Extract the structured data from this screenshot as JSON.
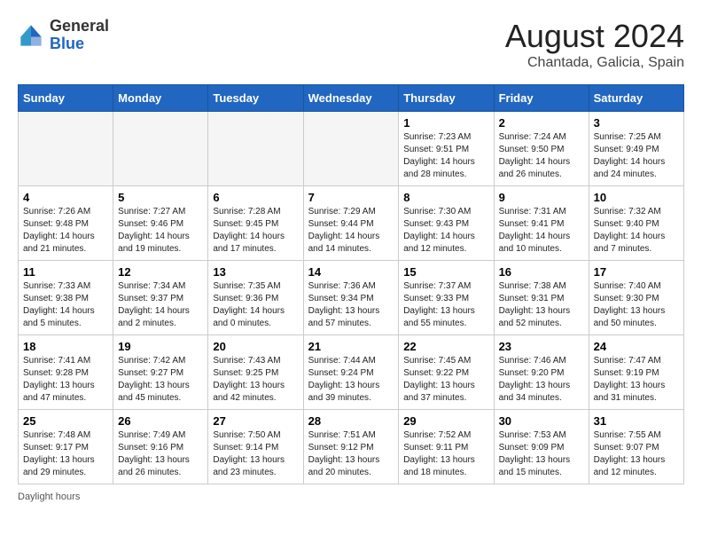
{
  "header": {
    "logo_general": "General",
    "logo_blue": "Blue",
    "title": "August 2024",
    "subtitle": "Chantada, Galicia, Spain"
  },
  "days_of_week": [
    "Sunday",
    "Monday",
    "Tuesday",
    "Wednesday",
    "Thursday",
    "Friday",
    "Saturday"
  ],
  "weeks": [
    [
      {
        "day": "",
        "info": ""
      },
      {
        "day": "",
        "info": ""
      },
      {
        "day": "",
        "info": ""
      },
      {
        "day": "",
        "info": ""
      },
      {
        "day": "1",
        "info": "Sunrise: 7:23 AM\nSunset: 9:51 PM\nDaylight: 14 hours\nand 28 minutes."
      },
      {
        "day": "2",
        "info": "Sunrise: 7:24 AM\nSunset: 9:50 PM\nDaylight: 14 hours\nand 26 minutes."
      },
      {
        "day": "3",
        "info": "Sunrise: 7:25 AM\nSunset: 9:49 PM\nDaylight: 14 hours\nand 24 minutes."
      }
    ],
    [
      {
        "day": "4",
        "info": "Sunrise: 7:26 AM\nSunset: 9:48 PM\nDaylight: 14 hours\nand 21 minutes."
      },
      {
        "day": "5",
        "info": "Sunrise: 7:27 AM\nSunset: 9:46 PM\nDaylight: 14 hours\nand 19 minutes."
      },
      {
        "day": "6",
        "info": "Sunrise: 7:28 AM\nSunset: 9:45 PM\nDaylight: 14 hours\nand 17 minutes."
      },
      {
        "day": "7",
        "info": "Sunrise: 7:29 AM\nSunset: 9:44 PM\nDaylight: 14 hours\nand 14 minutes."
      },
      {
        "day": "8",
        "info": "Sunrise: 7:30 AM\nSunset: 9:43 PM\nDaylight: 14 hours\nand 12 minutes."
      },
      {
        "day": "9",
        "info": "Sunrise: 7:31 AM\nSunset: 9:41 PM\nDaylight: 14 hours\nand 10 minutes."
      },
      {
        "day": "10",
        "info": "Sunrise: 7:32 AM\nSunset: 9:40 PM\nDaylight: 14 hours\nand 7 minutes."
      }
    ],
    [
      {
        "day": "11",
        "info": "Sunrise: 7:33 AM\nSunset: 9:38 PM\nDaylight: 14 hours\nand 5 minutes."
      },
      {
        "day": "12",
        "info": "Sunrise: 7:34 AM\nSunset: 9:37 PM\nDaylight: 14 hours\nand 2 minutes."
      },
      {
        "day": "13",
        "info": "Sunrise: 7:35 AM\nSunset: 9:36 PM\nDaylight: 14 hours\nand 0 minutes."
      },
      {
        "day": "14",
        "info": "Sunrise: 7:36 AM\nSunset: 9:34 PM\nDaylight: 13 hours\nand 57 minutes."
      },
      {
        "day": "15",
        "info": "Sunrise: 7:37 AM\nSunset: 9:33 PM\nDaylight: 13 hours\nand 55 minutes."
      },
      {
        "day": "16",
        "info": "Sunrise: 7:38 AM\nSunset: 9:31 PM\nDaylight: 13 hours\nand 52 minutes."
      },
      {
        "day": "17",
        "info": "Sunrise: 7:40 AM\nSunset: 9:30 PM\nDaylight: 13 hours\nand 50 minutes."
      }
    ],
    [
      {
        "day": "18",
        "info": "Sunrise: 7:41 AM\nSunset: 9:28 PM\nDaylight: 13 hours\nand 47 minutes."
      },
      {
        "day": "19",
        "info": "Sunrise: 7:42 AM\nSunset: 9:27 PM\nDaylight: 13 hours\nand 45 minutes."
      },
      {
        "day": "20",
        "info": "Sunrise: 7:43 AM\nSunset: 9:25 PM\nDaylight: 13 hours\nand 42 minutes."
      },
      {
        "day": "21",
        "info": "Sunrise: 7:44 AM\nSunset: 9:24 PM\nDaylight: 13 hours\nand 39 minutes."
      },
      {
        "day": "22",
        "info": "Sunrise: 7:45 AM\nSunset: 9:22 PM\nDaylight: 13 hours\nand 37 minutes."
      },
      {
        "day": "23",
        "info": "Sunrise: 7:46 AM\nSunset: 9:20 PM\nDaylight: 13 hours\nand 34 minutes."
      },
      {
        "day": "24",
        "info": "Sunrise: 7:47 AM\nSunset: 9:19 PM\nDaylight: 13 hours\nand 31 minutes."
      }
    ],
    [
      {
        "day": "25",
        "info": "Sunrise: 7:48 AM\nSunset: 9:17 PM\nDaylight: 13 hours\nand 29 minutes."
      },
      {
        "day": "26",
        "info": "Sunrise: 7:49 AM\nSunset: 9:16 PM\nDaylight: 13 hours\nand 26 minutes."
      },
      {
        "day": "27",
        "info": "Sunrise: 7:50 AM\nSunset: 9:14 PM\nDaylight: 13 hours\nand 23 minutes."
      },
      {
        "day": "28",
        "info": "Sunrise: 7:51 AM\nSunset: 9:12 PM\nDaylight: 13 hours\nand 20 minutes."
      },
      {
        "day": "29",
        "info": "Sunrise: 7:52 AM\nSunset: 9:11 PM\nDaylight: 13 hours\nand 18 minutes."
      },
      {
        "day": "30",
        "info": "Sunrise: 7:53 AM\nSunset: 9:09 PM\nDaylight: 13 hours\nand 15 minutes."
      },
      {
        "day": "31",
        "info": "Sunrise: 7:55 AM\nSunset: 9:07 PM\nDaylight: 13 hours\nand 12 minutes."
      }
    ]
  ],
  "footer": {
    "note": "Daylight hours"
  }
}
